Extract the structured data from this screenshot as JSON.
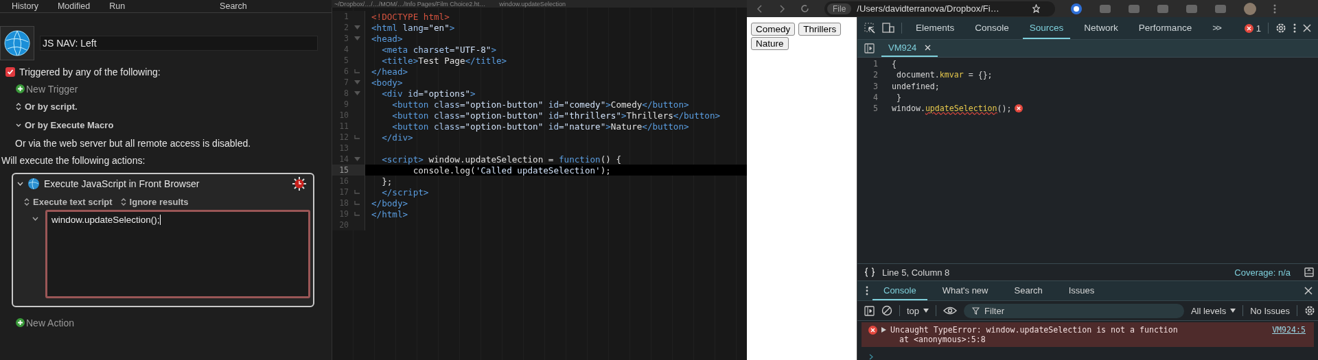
{
  "macro_editor": {
    "toolbar": [
      "History",
      "Modified",
      "Run",
      "Search"
    ],
    "macro_name": "JS NAV: Left",
    "trigger": {
      "label": "Triggered by any of the following:",
      "checked": true
    },
    "new_trigger": "New Trigger",
    "options": [
      {
        "label": "Or by script.",
        "kind": "popup"
      },
      {
        "label": "Or by Execute Macro",
        "kind": "disclosure"
      }
    ],
    "note": "Or via the web server but all remote access is disabled.",
    "actions_heading": "Will execute the following actions:",
    "action": {
      "title": "Execute JavaScript in Front Browser",
      "expanded": true,
      "options": [
        "Execute text script",
        "Ignore results"
      ],
      "script": "window.updateSelection();"
    },
    "new_action": "New Action"
  },
  "editor": {
    "path": "~/Dropbox/…/…/MOM/…/Info Pages/Film Choice2.ht…",
    "symbol": "window.updateSelection",
    "lines": [
      {
        "number": "1",
        "fold_start": false,
        "fold_end": false,
        "selected": false,
        "segments": [
          {
            "kind": "doctype",
            "t": "<!DOCTYPE html>"
          }
        ]
      },
      {
        "number": "2",
        "fold_start": true,
        "fold_end": false,
        "selected": false,
        "segments": [
          {
            "kind": "tag",
            "t": "<html "
          },
          {
            "kind": "attr",
            "t": "lang"
          },
          {
            "kind": "string",
            "t": "=\"en\""
          },
          {
            "kind": "tag",
            "t": ">"
          }
        ]
      },
      {
        "number": "3",
        "fold_start": true,
        "fold_end": false,
        "selected": false,
        "segments": [
          {
            "kind": "tag",
            "t": "<head>"
          }
        ]
      },
      {
        "number": "4",
        "fold_start": false,
        "fold_end": false,
        "selected": false,
        "segments": [
          {
            "kind": "tag",
            "t": "  <meta "
          },
          {
            "kind": "attr",
            "t": "charset"
          },
          {
            "kind": "string",
            "t": "=\"UTF-8\""
          },
          {
            "kind": "tag",
            "t": ">"
          }
        ]
      },
      {
        "number": "5",
        "fold_start": false,
        "fold_end": false,
        "selected": false,
        "segments": [
          {
            "kind": "tag",
            "t": "  <title>"
          },
          {
            "kind": "text",
            "t": "Test Page"
          },
          {
            "kind": "tag",
            "t": "</title>"
          }
        ]
      },
      {
        "number": "6",
        "fold_start": false,
        "fold_end": true,
        "selected": false,
        "segments": [
          {
            "kind": "tag",
            "t": "</head>"
          }
        ]
      },
      {
        "number": "7",
        "fold_start": true,
        "fold_end": false,
        "selected": false,
        "segments": [
          {
            "kind": "tag",
            "t": "<body>"
          }
        ]
      },
      {
        "number": "8",
        "fold_start": true,
        "fold_end": false,
        "selected": false,
        "segments": [
          {
            "kind": "tag",
            "t": "  <div "
          },
          {
            "kind": "attr",
            "t": "id"
          },
          {
            "kind": "string",
            "t": "=\"options\""
          },
          {
            "kind": "tag",
            "t": ">"
          }
        ]
      },
      {
        "number": "9",
        "fold_start": false,
        "fold_end": false,
        "selected": false,
        "segments": [
          {
            "kind": "tag",
            "t": "    <button "
          },
          {
            "kind": "attr",
            "t": "class"
          },
          {
            "kind": "string",
            "t": "=\"option-button\" "
          },
          {
            "kind": "attr",
            "t": "id"
          },
          {
            "kind": "string",
            "t": "=\"comedy\""
          },
          {
            "kind": "tag",
            "t": ">"
          },
          {
            "kind": "text",
            "t": "Comedy"
          },
          {
            "kind": "tag",
            "t": "</button>"
          }
        ]
      },
      {
        "number": "10",
        "fold_start": false,
        "fold_end": false,
        "selected": false,
        "segments": [
          {
            "kind": "tag",
            "t": "    <button "
          },
          {
            "kind": "attr",
            "t": "class"
          },
          {
            "kind": "string",
            "t": "=\"option-button\" "
          },
          {
            "kind": "attr",
            "t": "id"
          },
          {
            "kind": "string",
            "t": "=\"thrillers\""
          },
          {
            "kind": "tag",
            "t": ">"
          },
          {
            "kind": "text",
            "t": "Thrillers"
          },
          {
            "kind": "tag",
            "t": "</button>"
          }
        ]
      },
      {
        "number": "11",
        "fold_start": false,
        "fold_end": false,
        "selected": false,
        "segments": [
          {
            "kind": "tag",
            "t": "    <button "
          },
          {
            "kind": "attr",
            "t": "class"
          },
          {
            "kind": "string",
            "t": "=\"option-button\" "
          },
          {
            "kind": "attr",
            "t": "id"
          },
          {
            "kind": "string",
            "t": "=\"nature\""
          },
          {
            "kind": "tag",
            "t": ">"
          },
          {
            "kind": "text",
            "t": "Nature"
          },
          {
            "kind": "tag",
            "t": "</button>"
          }
        ]
      },
      {
        "number": "12",
        "fold_start": false,
        "fold_end": true,
        "selected": false,
        "segments": [
          {
            "kind": "tag",
            "t": "  </div>"
          }
        ]
      },
      {
        "number": "13",
        "fold_start": false,
        "fold_end": false,
        "selected": false
      },
      {
        "number": "14",
        "fold_start": true,
        "fold_end": false,
        "selected": false,
        "segments": [
          {
            "kind": "tag",
            "t": "  <script>"
          },
          {
            "kind": "text",
            "t": " window.updateSelection = "
          },
          {
            "kind": "keyword",
            "t": "function"
          },
          {
            "kind": "text",
            "t": "() {"
          }
        ]
      },
      {
        "number": "15",
        "fold_start": false,
        "fold_end": false,
        "selected": true,
        "segments": [
          {
            "kind": "text",
            "t": "        console.log("
          },
          {
            "kind": "string",
            "t": "'Called updateSelection'"
          },
          {
            "kind": "text",
            "t": ");"
          }
        ]
      },
      {
        "number": "16",
        "fold_start": false,
        "fold_end": false,
        "selected": false,
        "segments": [
          {
            "kind": "text",
            "t": "  };"
          }
        ]
      },
      {
        "number": "17",
        "fold_start": false,
        "fold_end": true,
        "selected": false,
        "segments": [
          {
            "kind": "tag",
            "t": "  </script>"
          }
        ]
      },
      {
        "number": "18",
        "fold_start": false,
        "fold_end": true,
        "selected": false,
        "segments": [
          {
            "kind": "tag",
            "t": "</body>"
          }
        ]
      },
      {
        "number": "19",
        "fold_start": false,
        "fold_end": true,
        "selected": false,
        "segments": [
          {
            "kind": "tag",
            "t": "</html>"
          }
        ]
      },
      {
        "number": "20",
        "fold_start": false,
        "fold_end": false,
        "selected": false
      }
    ]
  },
  "browser": {
    "url_chip": "File",
    "url": "/Users/davidterranova/Dropbox/Fi…",
    "page_buttons": [
      "Comedy",
      "Thrillers",
      "Nature"
    ]
  },
  "devtools": {
    "tabs": [
      {
        "label": "Elements",
        "selected": false
      },
      {
        "label": "Console",
        "selected": false
      },
      {
        "label": "Sources",
        "selected": true
      },
      {
        "label": "Network",
        "selected": false
      },
      {
        "label": "Performance",
        "selected": false
      }
    ],
    "more": ">>",
    "error_count": "1",
    "file_tab": "VM924",
    "code": [
      {
        "number": "1",
        "error": false,
        "segments": [
          {
            "kind": "plain",
            "t": "{"
          }
        ]
      },
      {
        "number": "2",
        "error": false,
        "segments": [
          {
            "kind": "plain",
            "t": " document."
          },
          {
            "kind": "prop",
            "t": "kmvar"
          },
          {
            "kind": "plain",
            "t": " = {};"
          }
        ]
      },
      {
        "number": "3",
        "error": false,
        "segments": [
          {
            "kind": "plain",
            "t": "undefined;"
          }
        ]
      },
      {
        "number": "4",
        "error": false,
        "segments": [
          {
            "kind": "plain",
            "t": " }"
          }
        ]
      },
      {
        "number": "5",
        "error": true,
        "segments": [
          {
            "kind": "plain",
            "t": "window."
          },
          {
            "kind": "error",
            "t": "updateSelection"
          },
          {
            "kind": "plain",
            "t": "();"
          }
        ]
      }
    ],
    "status": {
      "position": "Line 5, Column 8",
      "coverage": "Coverage: n/a"
    },
    "drawer_tabs": [
      {
        "label": "Console",
        "selected": true
      },
      {
        "label": "What's new",
        "selected": false
      },
      {
        "label": "Search",
        "selected": false
      },
      {
        "label": "Issues",
        "selected": false
      }
    ],
    "context": "top",
    "filter_placeholder": "Filter",
    "levels": "All levels",
    "issues": "No Issues",
    "error": {
      "message": "Uncaught TypeError: window.updateSelection is not a function",
      "trace": "at <anonymous>:5:8",
      "source": "VM924:5"
    }
  }
}
